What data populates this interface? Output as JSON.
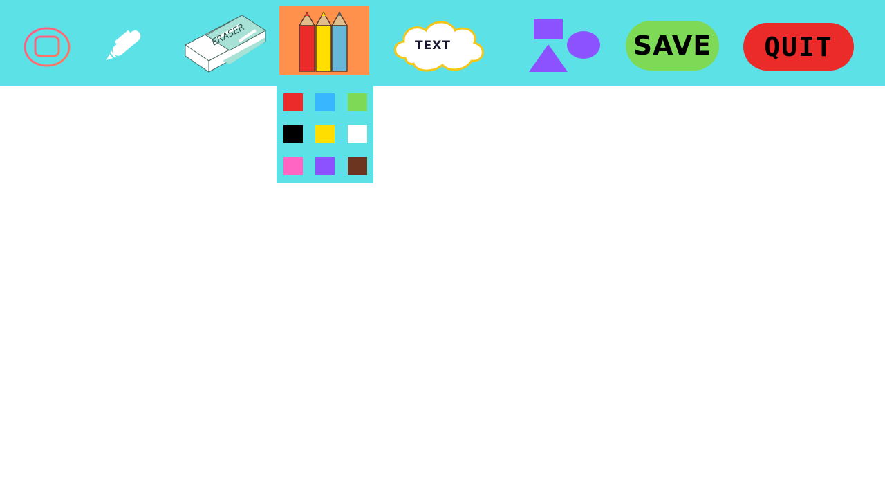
{
  "toolbar": {
    "background": "#5ce1e6",
    "tools": [
      {
        "id": "menu",
        "icon": "menu-message-icon"
      },
      {
        "id": "pen",
        "icon": "pen-icon",
        "color": "#ffffff"
      },
      {
        "id": "eraser",
        "icon": "eraser-icon",
        "label": "ERASER"
      },
      {
        "id": "colors",
        "icon": "colored-pencils-icon",
        "selected": true,
        "highlight": "#ff914d"
      },
      {
        "id": "text",
        "icon": "text-cloud-icon",
        "label": "TEXT"
      },
      {
        "id": "shapes",
        "icon": "shapes-icon",
        "color": "#8c52ff"
      }
    ],
    "save": {
      "label": "SAVE",
      "color": "#7ed957"
    },
    "quit": {
      "label": "QUIT",
      "color": "#eb2a2a"
    }
  },
  "palette": {
    "colors": [
      "#eb2a2a",
      "#38b6ff",
      "#7ed957",
      "#000000",
      "#ffde00",
      "#ffffff",
      "#ff66c4",
      "#8c52ff",
      "#6b3520"
    ]
  }
}
